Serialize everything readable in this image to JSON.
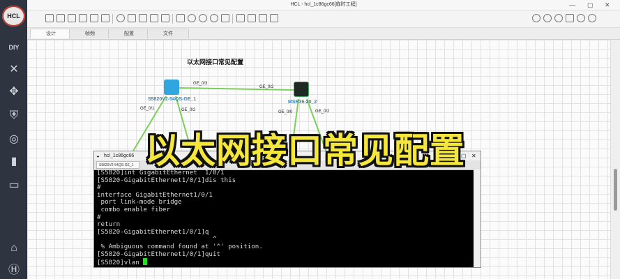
{
  "app": {
    "logo_text": "HCL",
    "window_title": "HCL - hcl_1c86gc66[临时工程]"
  },
  "sidebar": {
    "items": [
      {
        "icon": "diy-icon"
      },
      {
        "icon": "network-icon"
      },
      {
        "icon": "move-icon"
      },
      {
        "icon": "security-icon"
      },
      {
        "icon": "wireless-icon"
      },
      {
        "icon": "server-icon"
      },
      {
        "icon": "monitor-icon"
      },
      {
        "icon": "home-icon"
      },
      {
        "icon": "h-icon"
      }
    ]
  },
  "tabs": [
    {
      "label": "设计",
      "active": true
    },
    {
      "label": "帧频",
      "active": false
    },
    {
      "label": "配置",
      "active": false
    },
    {
      "label": "文件",
      "active": false
    }
  ],
  "topology": {
    "title": "以太网接口常见配置",
    "devices": [
      {
        "name": "S5820V2-54QS-GE_1",
        "type": "switch"
      },
      {
        "name": "MSR36-20_2",
        "type": "router"
      }
    ],
    "ports": [
      "GE_0/3",
      "GE_0/2",
      "GE_0/1",
      "GE_0/2",
      "GE_0/0",
      "GE_0/2"
    ]
  },
  "terminal": {
    "window_title": "hcl_1c86gc66",
    "tab_label": "S5820V2-54QS-GE_1",
    "lines": [
      "[S5820]int GigabitEthernet  1/0/1",
      "[S5820-GigabitEthernet1/0/1]dis this",
      "#",
      "interface GigabitEthernet1/0/1",
      " port link-mode bridge",
      " combo enable fiber",
      "#",
      "return",
      "[S5820-GigabitEthernet1/0/1]q",
      "                              ^",
      " % Ambiguous command found at '^' position.",
      "[S5820-GigabitEthernet1/0/1]quit"
    ],
    "prompt_line": "[S5820]vlan "
  },
  "overlay_caption": "以太网接口常见配置",
  "colors": {
    "caption_fill": "#f4e63a",
    "link_green": "#7ccf5a",
    "cursor_green": "#22dd22",
    "switch_blue": "#2fa6e0"
  }
}
